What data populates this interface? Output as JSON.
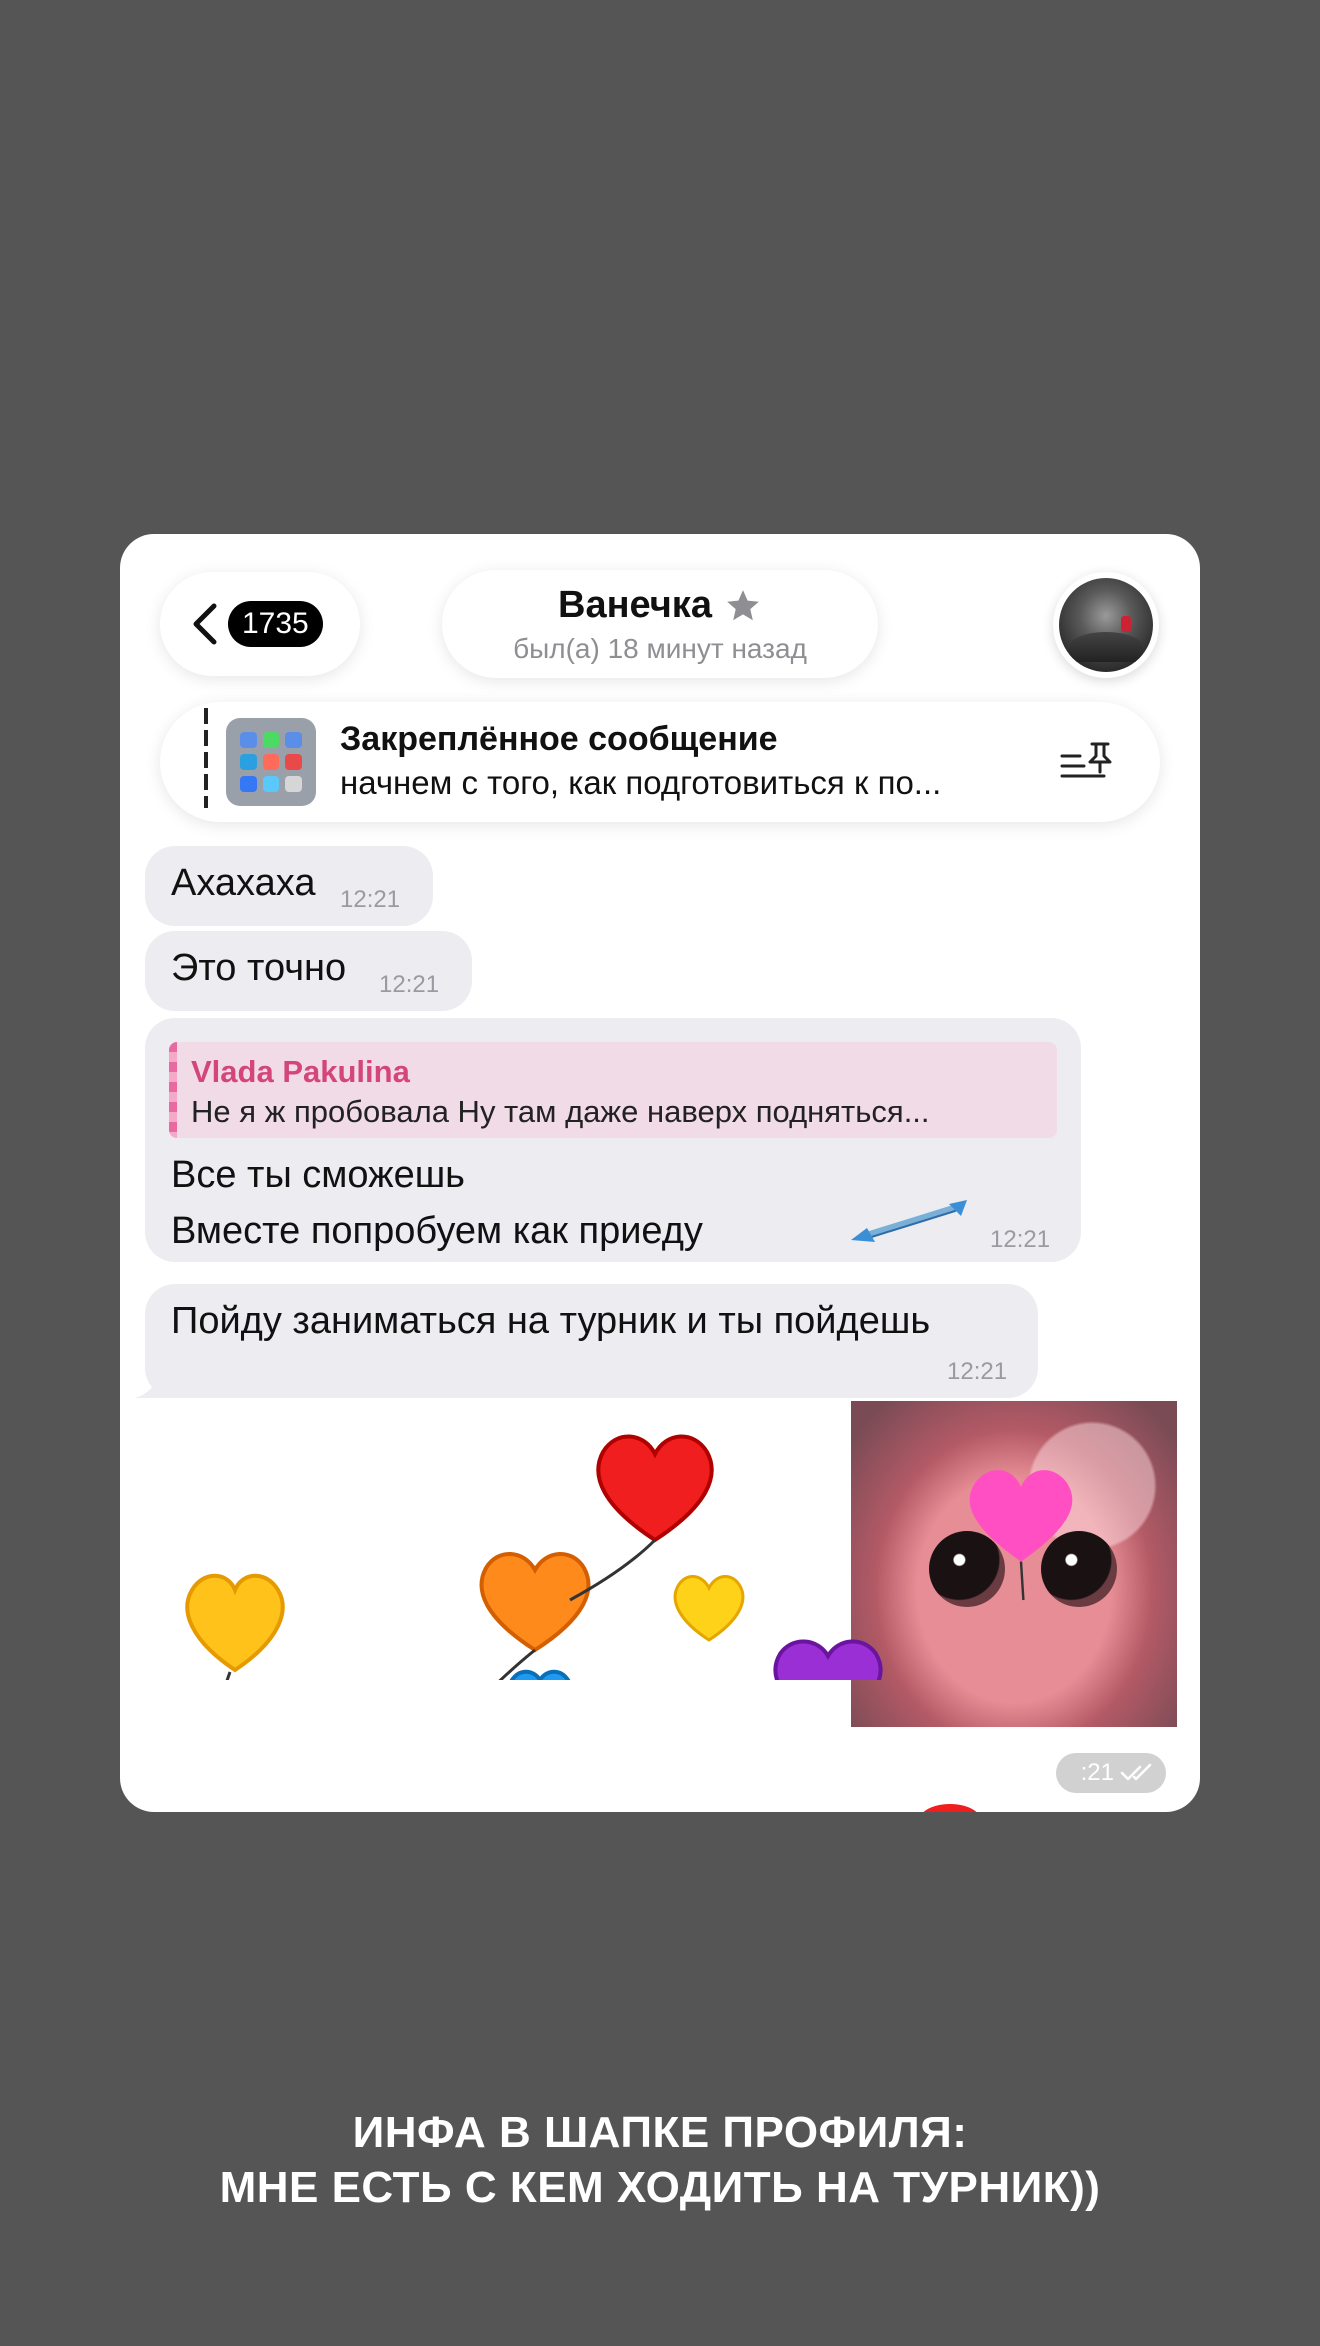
{
  "header": {
    "back_count": "1735",
    "chat_name": "Ванечка",
    "chat_status": "был(а) 18 минут назад"
  },
  "pinned": {
    "title": "Закреплённое сообщение",
    "text": "начнем с того, как подготовиться к по..."
  },
  "messages": [
    {
      "text": "Ахахаха",
      "time": "12:21"
    },
    {
      "text": "Это точно",
      "time": "12:21"
    },
    {
      "reply_name": "Vlada Pakulina",
      "reply_text": "Не я ж пробовала Ну там даже наверх подняться...",
      "line1": "Все ты сможешь",
      "line2": "Вместе попробуем как приеду",
      "time": "12:21"
    },
    {
      "text": "Пойду заниматься на турник и ты пойдешь",
      "time": "12:21"
    }
  ],
  "sticker_time": ":21",
  "caption": {
    "line1": "ИНФА В ШАПКЕ ПРОФИЛЯ:",
    "line2": "МНЕ ЕСТЬ С КЕМ ХОДИТЬ НА ТУРНИК))"
  },
  "colors": {
    "background": "#555555",
    "bubble": "#ececf1",
    "reply_accent": "#d4457c"
  }
}
